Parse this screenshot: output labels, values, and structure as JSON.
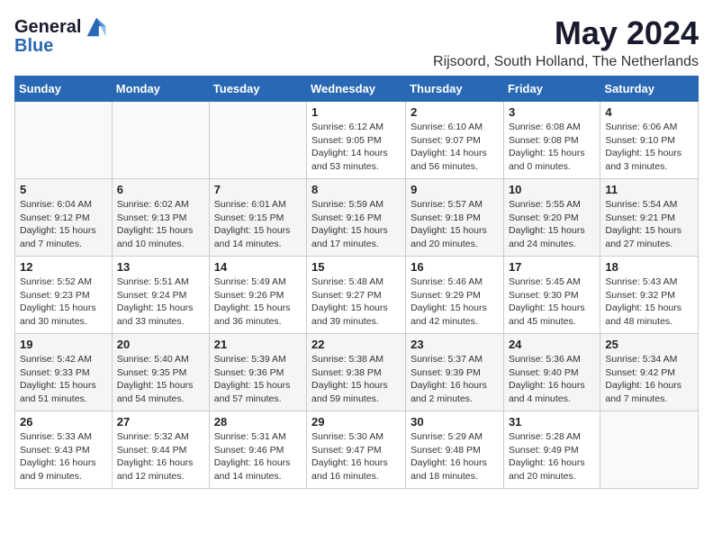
{
  "logo": {
    "line1": "General",
    "line2": "Blue"
  },
  "title": "May 2024",
  "location": "Rijsoord, South Holland, The Netherlands",
  "weekdays": [
    "Sunday",
    "Monday",
    "Tuesday",
    "Wednesday",
    "Thursday",
    "Friday",
    "Saturday"
  ],
  "weeks": [
    [
      {
        "day": "",
        "info": ""
      },
      {
        "day": "",
        "info": ""
      },
      {
        "day": "",
        "info": ""
      },
      {
        "day": "1",
        "info": "Sunrise: 6:12 AM\nSunset: 9:05 PM\nDaylight: 14 hours and 53 minutes."
      },
      {
        "day": "2",
        "info": "Sunrise: 6:10 AM\nSunset: 9:07 PM\nDaylight: 14 hours and 56 minutes."
      },
      {
        "day": "3",
        "info": "Sunrise: 6:08 AM\nSunset: 9:08 PM\nDaylight: 15 hours and 0 minutes."
      },
      {
        "day": "4",
        "info": "Sunrise: 6:06 AM\nSunset: 9:10 PM\nDaylight: 15 hours and 3 minutes."
      }
    ],
    [
      {
        "day": "5",
        "info": "Sunrise: 6:04 AM\nSunset: 9:12 PM\nDaylight: 15 hours and 7 minutes."
      },
      {
        "day": "6",
        "info": "Sunrise: 6:02 AM\nSunset: 9:13 PM\nDaylight: 15 hours and 10 minutes."
      },
      {
        "day": "7",
        "info": "Sunrise: 6:01 AM\nSunset: 9:15 PM\nDaylight: 15 hours and 14 minutes."
      },
      {
        "day": "8",
        "info": "Sunrise: 5:59 AM\nSunset: 9:16 PM\nDaylight: 15 hours and 17 minutes."
      },
      {
        "day": "9",
        "info": "Sunrise: 5:57 AM\nSunset: 9:18 PM\nDaylight: 15 hours and 20 minutes."
      },
      {
        "day": "10",
        "info": "Sunrise: 5:55 AM\nSunset: 9:20 PM\nDaylight: 15 hours and 24 minutes."
      },
      {
        "day": "11",
        "info": "Sunrise: 5:54 AM\nSunset: 9:21 PM\nDaylight: 15 hours and 27 minutes."
      }
    ],
    [
      {
        "day": "12",
        "info": "Sunrise: 5:52 AM\nSunset: 9:23 PM\nDaylight: 15 hours and 30 minutes."
      },
      {
        "day": "13",
        "info": "Sunrise: 5:51 AM\nSunset: 9:24 PM\nDaylight: 15 hours and 33 minutes."
      },
      {
        "day": "14",
        "info": "Sunrise: 5:49 AM\nSunset: 9:26 PM\nDaylight: 15 hours and 36 minutes."
      },
      {
        "day": "15",
        "info": "Sunrise: 5:48 AM\nSunset: 9:27 PM\nDaylight: 15 hours and 39 minutes."
      },
      {
        "day": "16",
        "info": "Sunrise: 5:46 AM\nSunset: 9:29 PM\nDaylight: 15 hours and 42 minutes."
      },
      {
        "day": "17",
        "info": "Sunrise: 5:45 AM\nSunset: 9:30 PM\nDaylight: 15 hours and 45 minutes."
      },
      {
        "day": "18",
        "info": "Sunrise: 5:43 AM\nSunset: 9:32 PM\nDaylight: 15 hours and 48 minutes."
      }
    ],
    [
      {
        "day": "19",
        "info": "Sunrise: 5:42 AM\nSunset: 9:33 PM\nDaylight: 15 hours and 51 minutes."
      },
      {
        "day": "20",
        "info": "Sunrise: 5:40 AM\nSunset: 9:35 PM\nDaylight: 15 hours and 54 minutes."
      },
      {
        "day": "21",
        "info": "Sunrise: 5:39 AM\nSunset: 9:36 PM\nDaylight: 15 hours and 57 minutes."
      },
      {
        "day": "22",
        "info": "Sunrise: 5:38 AM\nSunset: 9:38 PM\nDaylight: 15 hours and 59 minutes."
      },
      {
        "day": "23",
        "info": "Sunrise: 5:37 AM\nSunset: 9:39 PM\nDaylight: 16 hours and 2 minutes."
      },
      {
        "day": "24",
        "info": "Sunrise: 5:36 AM\nSunset: 9:40 PM\nDaylight: 16 hours and 4 minutes."
      },
      {
        "day": "25",
        "info": "Sunrise: 5:34 AM\nSunset: 9:42 PM\nDaylight: 16 hours and 7 minutes."
      }
    ],
    [
      {
        "day": "26",
        "info": "Sunrise: 5:33 AM\nSunset: 9:43 PM\nDaylight: 16 hours and 9 minutes."
      },
      {
        "day": "27",
        "info": "Sunrise: 5:32 AM\nSunset: 9:44 PM\nDaylight: 16 hours and 12 minutes."
      },
      {
        "day": "28",
        "info": "Sunrise: 5:31 AM\nSunset: 9:46 PM\nDaylight: 16 hours and 14 minutes."
      },
      {
        "day": "29",
        "info": "Sunrise: 5:30 AM\nSunset: 9:47 PM\nDaylight: 16 hours and 16 minutes."
      },
      {
        "day": "30",
        "info": "Sunrise: 5:29 AM\nSunset: 9:48 PM\nDaylight: 16 hours and 18 minutes."
      },
      {
        "day": "31",
        "info": "Sunrise: 5:28 AM\nSunset: 9:49 PM\nDaylight: 16 hours and 20 minutes."
      },
      {
        "day": "",
        "info": ""
      }
    ]
  ]
}
